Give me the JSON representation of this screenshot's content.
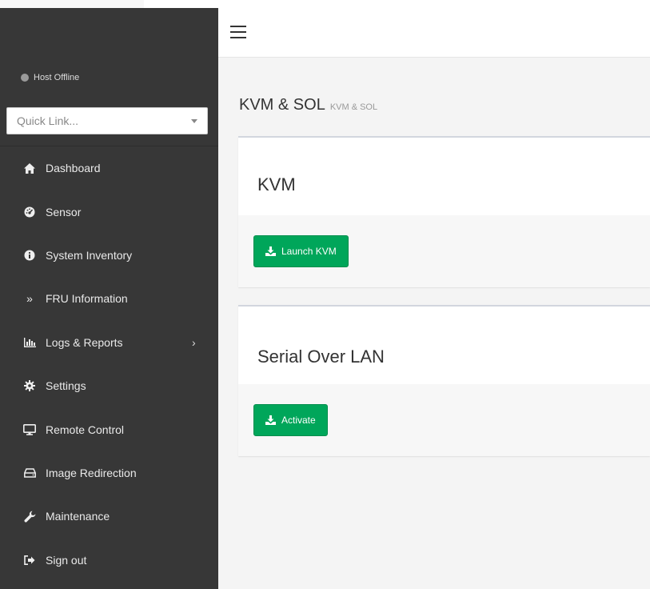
{
  "sidebar": {
    "status": "Host Offline",
    "quick_link": {
      "placeholder": "Quick Link..."
    },
    "items": [
      {
        "label": "Dashboard",
        "icon": "home-icon"
      },
      {
        "label": "Sensor",
        "icon": "dashboard-gauge-icon"
      },
      {
        "label": "System Inventory",
        "icon": "info-circle-icon"
      },
      {
        "label": "FRU Information",
        "icon": "double-chevron-right-icon"
      },
      {
        "label": "Logs & Reports",
        "icon": "bar-chart-icon",
        "arrow": "›"
      },
      {
        "label": "Settings",
        "icon": "gear-icon"
      },
      {
        "label": "Remote Control",
        "icon": "desktop-monitor-icon"
      },
      {
        "label": "Image Redirection",
        "icon": "hdd-drive-icon"
      },
      {
        "label": "Maintenance",
        "icon": "wrench-icon"
      },
      {
        "label": "Sign out",
        "icon": "sign-out-icon"
      }
    ]
  },
  "header": {
    "menu_icon": "hamburger-menu-icon"
  },
  "main": {
    "title": "KVM & SOL",
    "subtitle": "KVM & SOL",
    "cards": [
      {
        "title": "KVM",
        "button": "Launch KVM",
        "button_icon": "download-icon"
      },
      {
        "title": "Serial Over LAN",
        "button": "Activate",
        "button_icon": "download-icon"
      }
    ]
  },
  "colors": {
    "sidebar_bg": "#373737",
    "accent_green": "#00a65a",
    "offline_dot": "#9a9a9a"
  }
}
